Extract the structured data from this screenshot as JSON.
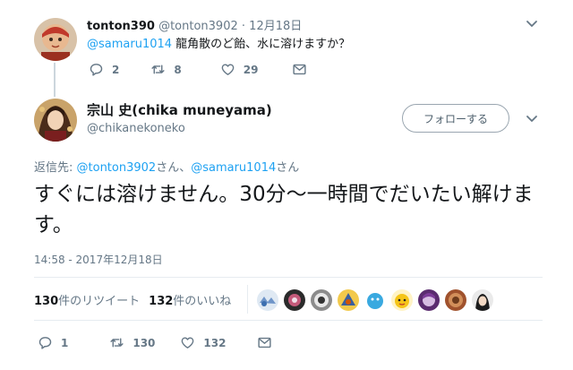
{
  "reply": {
    "display_name": "tonton390",
    "handle": "@tonton3902",
    "separator": "·",
    "date": "12月18日",
    "mention": "@samaru1014",
    "text": " 龍角散のど飴、水に溶けますか？",
    "reply_count": "2",
    "retweet_count": "8",
    "like_count": "29"
  },
  "tweet": {
    "display_name": "宗山 史(chika muneyama)",
    "handle": "@chikanekoneko",
    "follow_label": "フォローする",
    "replying_prefix": "返信先: ",
    "replying_to_1": "@tonton3902",
    "replying_joiner": "さん、",
    "replying_to_2": "@samaru1014",
    "replying_suffix": "さん",
    "text": "すぐには溶けません。30分〜一時間でだいたい解けます。",
    "timestamp": "14:58 - 2017年12月18日",
    "retweets_num": "130",
    "retweets_label": "件のリツイート",
    "likes_num": "132",
    "likes_label": "件のいいね",
    "reply_count": "1",
    "retweet_count": "130",
    "like_count": "132"
  },
  "icons": {
    "reply": "reply-icon",
    "retweet": "retweet-icon",
    "like": "heart-icon",
    "dm": "envelope-icon",
    "more": "chevron-down-icon"
  },
  "colors": {
    "link": "#1da1f2",
    "muted": "#657786",
    "text": "#14171a",
    "border": "#e6ecf0"
  },
  "likers": [
    "liker-1",
    "liker-2",
    "liker-3",
    "liker-4",
    "liker-5",
    "liker-6",
    "liker-7",
    "liker-8",
    "liker-9"
  ]
}
